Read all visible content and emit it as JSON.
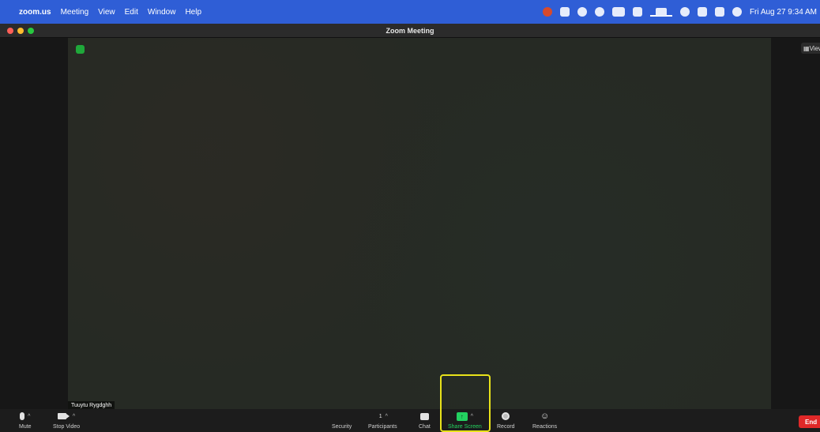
{
  "menubar": {
    "app_name": "zoom.us",
    "menus": [
      "Meeting",
      "View",
      "Edit",
      "Window",
      "Help"
    ],
    "clock": "Fri Aug 27  9:34 AM"
  },
  "window": {
    "title": "Zoom Meeting"
  },
  "meeting": {
    "view_label": "View",
    "participant_name": "Tuuytu Rygdghh",
    "participants_count": "1"
  },
  "toolbar": {
    "mute": "Mute",
    "stop_video": "Stop Video",
    "security": "Security",
    "participants": "Participants",
    "chat": "Chat",
    "share_screen": "Share Screen",
    "record": "Record",
    "reactions": "Reactions",
    "end": "End"
  },
  "colors": {
    "menubar": "#2f5ed6",
    "share_green": "#23d160",
    "highlight": "#e8e21a",
    "end_red": "#e02828"
  }
}
